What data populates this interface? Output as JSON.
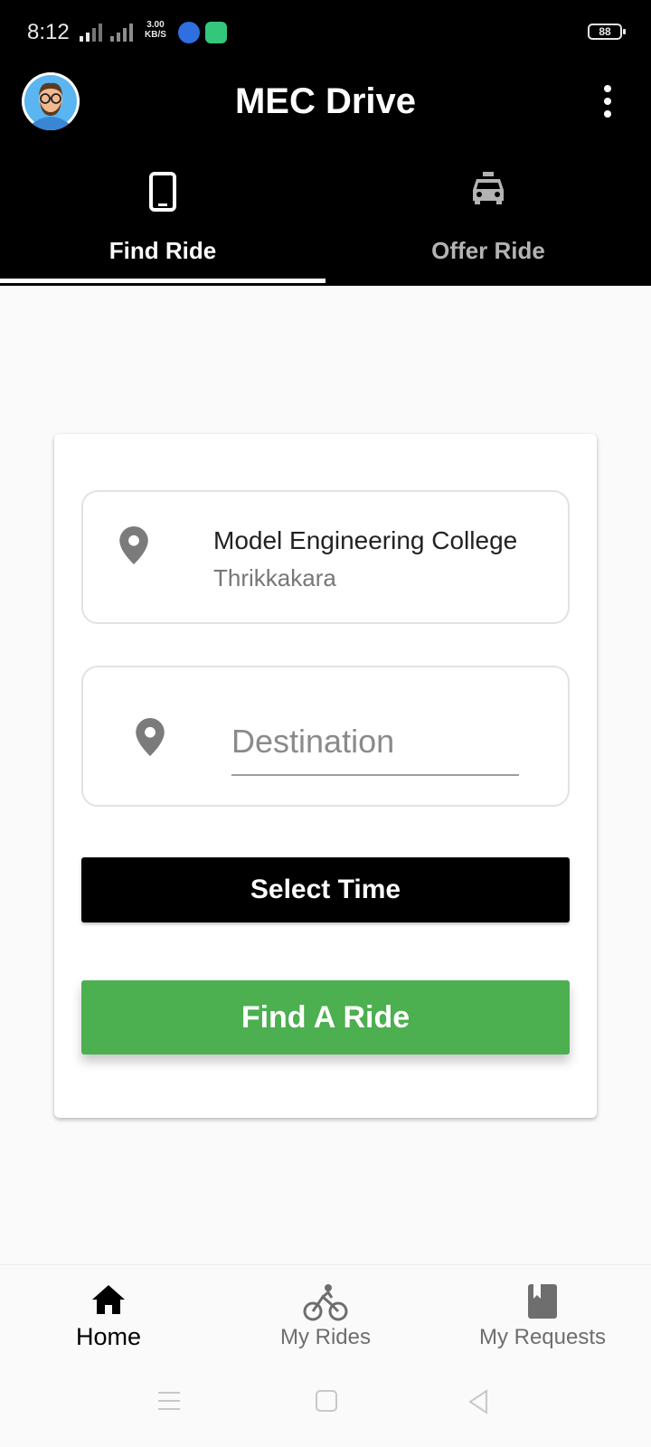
{
  "status_bar": {
    "time": "8:12",
    "net_speed_value": "3.00",
    "net_speed_unit": "KB/S",
    "battery": "88"
  },
  "app_bar": {
    "title": "MEC Drive",
    "tabs": [
      {
        "label": "Find Ride",
        "icon": "phone-icon",
        "selected": true
      },
      {
        "label": "Offer Ride",
        "icon": "taxi-icon",
        "selected": false
      }
    ]
  },
  "form": {
    "origin": {
      "name": "Model Engineering College",
      "subtitle": "Thrikkakara"
    },
    "destination": {
      "placeholder": "Destination",
      "value": ""
    },
    "select_time_label": "Select Time",
    "find_ride_label": "Find A Ride"
  },
  "bottom_nav": {
    "items": [
      {
        "label": "Home",
        "icon": "home-icon",
        "selected": true
      },
      {
        "label": "My Rides",
        "icon": "bicycle-icon",
        "selected": false
      },
      {
        "label": "My Requests",
        "icon": "book-icon",
        "selected": false
      }
    ]
  },
  "colors": {
    "app_bar_bg": "#000000",
    "find_button_bg": "#4caf50",
    "page_bg": "#fafafa"
  }
}
